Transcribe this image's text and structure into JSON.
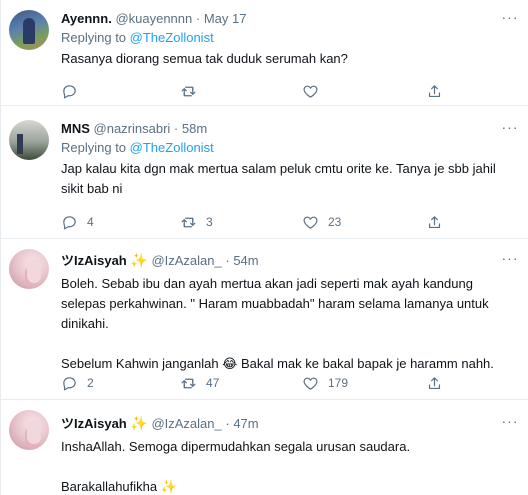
{
  "tweets": [
    {
      "name": "Ayennn.",
      "handle": "@kuayennnn",
      "sep": "·",
      "time": "May 17",
      "replying_prefix": "Replying to",
      "replying_to": "@TheZollonist",
      "lines": [
        "Rasanya diorang semua tak duduk serumah kan?"
      ],
      "replies": "",
      "retweets": "",
      "likes": ""
    },
    {
      "name": "MNS",
      "handle": "@nazrinsabri",
      "sep": "·",
      "time": "58m",
      "replying_prefix": "Replying to",
      "replying_to": "@TheZollonist",
      "lines": [
        "Jap kalau kita dgn mak mertua salam peluk cmtu orite ke. Tanya je sbb jahil",
        "sikit bab ni"
      ],
      "replies": "4",
      "retweets": "3",
      "likes": "23"
    },
    {
      "name": "ツIzAisyah",
      "name_emoji": "✨",
      "handle": "@IzAzalan_",
      "sep": "·",
      "time": "54m",
      "lines": [
        "Boleh. Sebab ibu dan ayah mertua akan jadi seperti mak ayah kandung",
        "selepas perkahwinan. \" Haram muabbadah\" haram selama lamanya untuk",
        "dinikahi."
      ],
      "lines2": [
        "Sebelum Kahwin janganlah 😂 Bakal mak ke bakal bapak je haramm nahh."
      ],
      "replies": "2",
      "retweets": "47",
      "likes": "179"
    },
    {
      "name": "ツIzAisyah",
      "name_emoji": "✨",
      "handle": "@IzAzalan_",
      "sep": "·",
      "time": "47m",
      "lines": [
        "InshaAllah. Semoga dipermudahkan segala urusan saudara."
      ],
      "lines2": [
        "Barakallahufikha ✨"
      ]
    }
  ],
  "more_label": "···"
}
